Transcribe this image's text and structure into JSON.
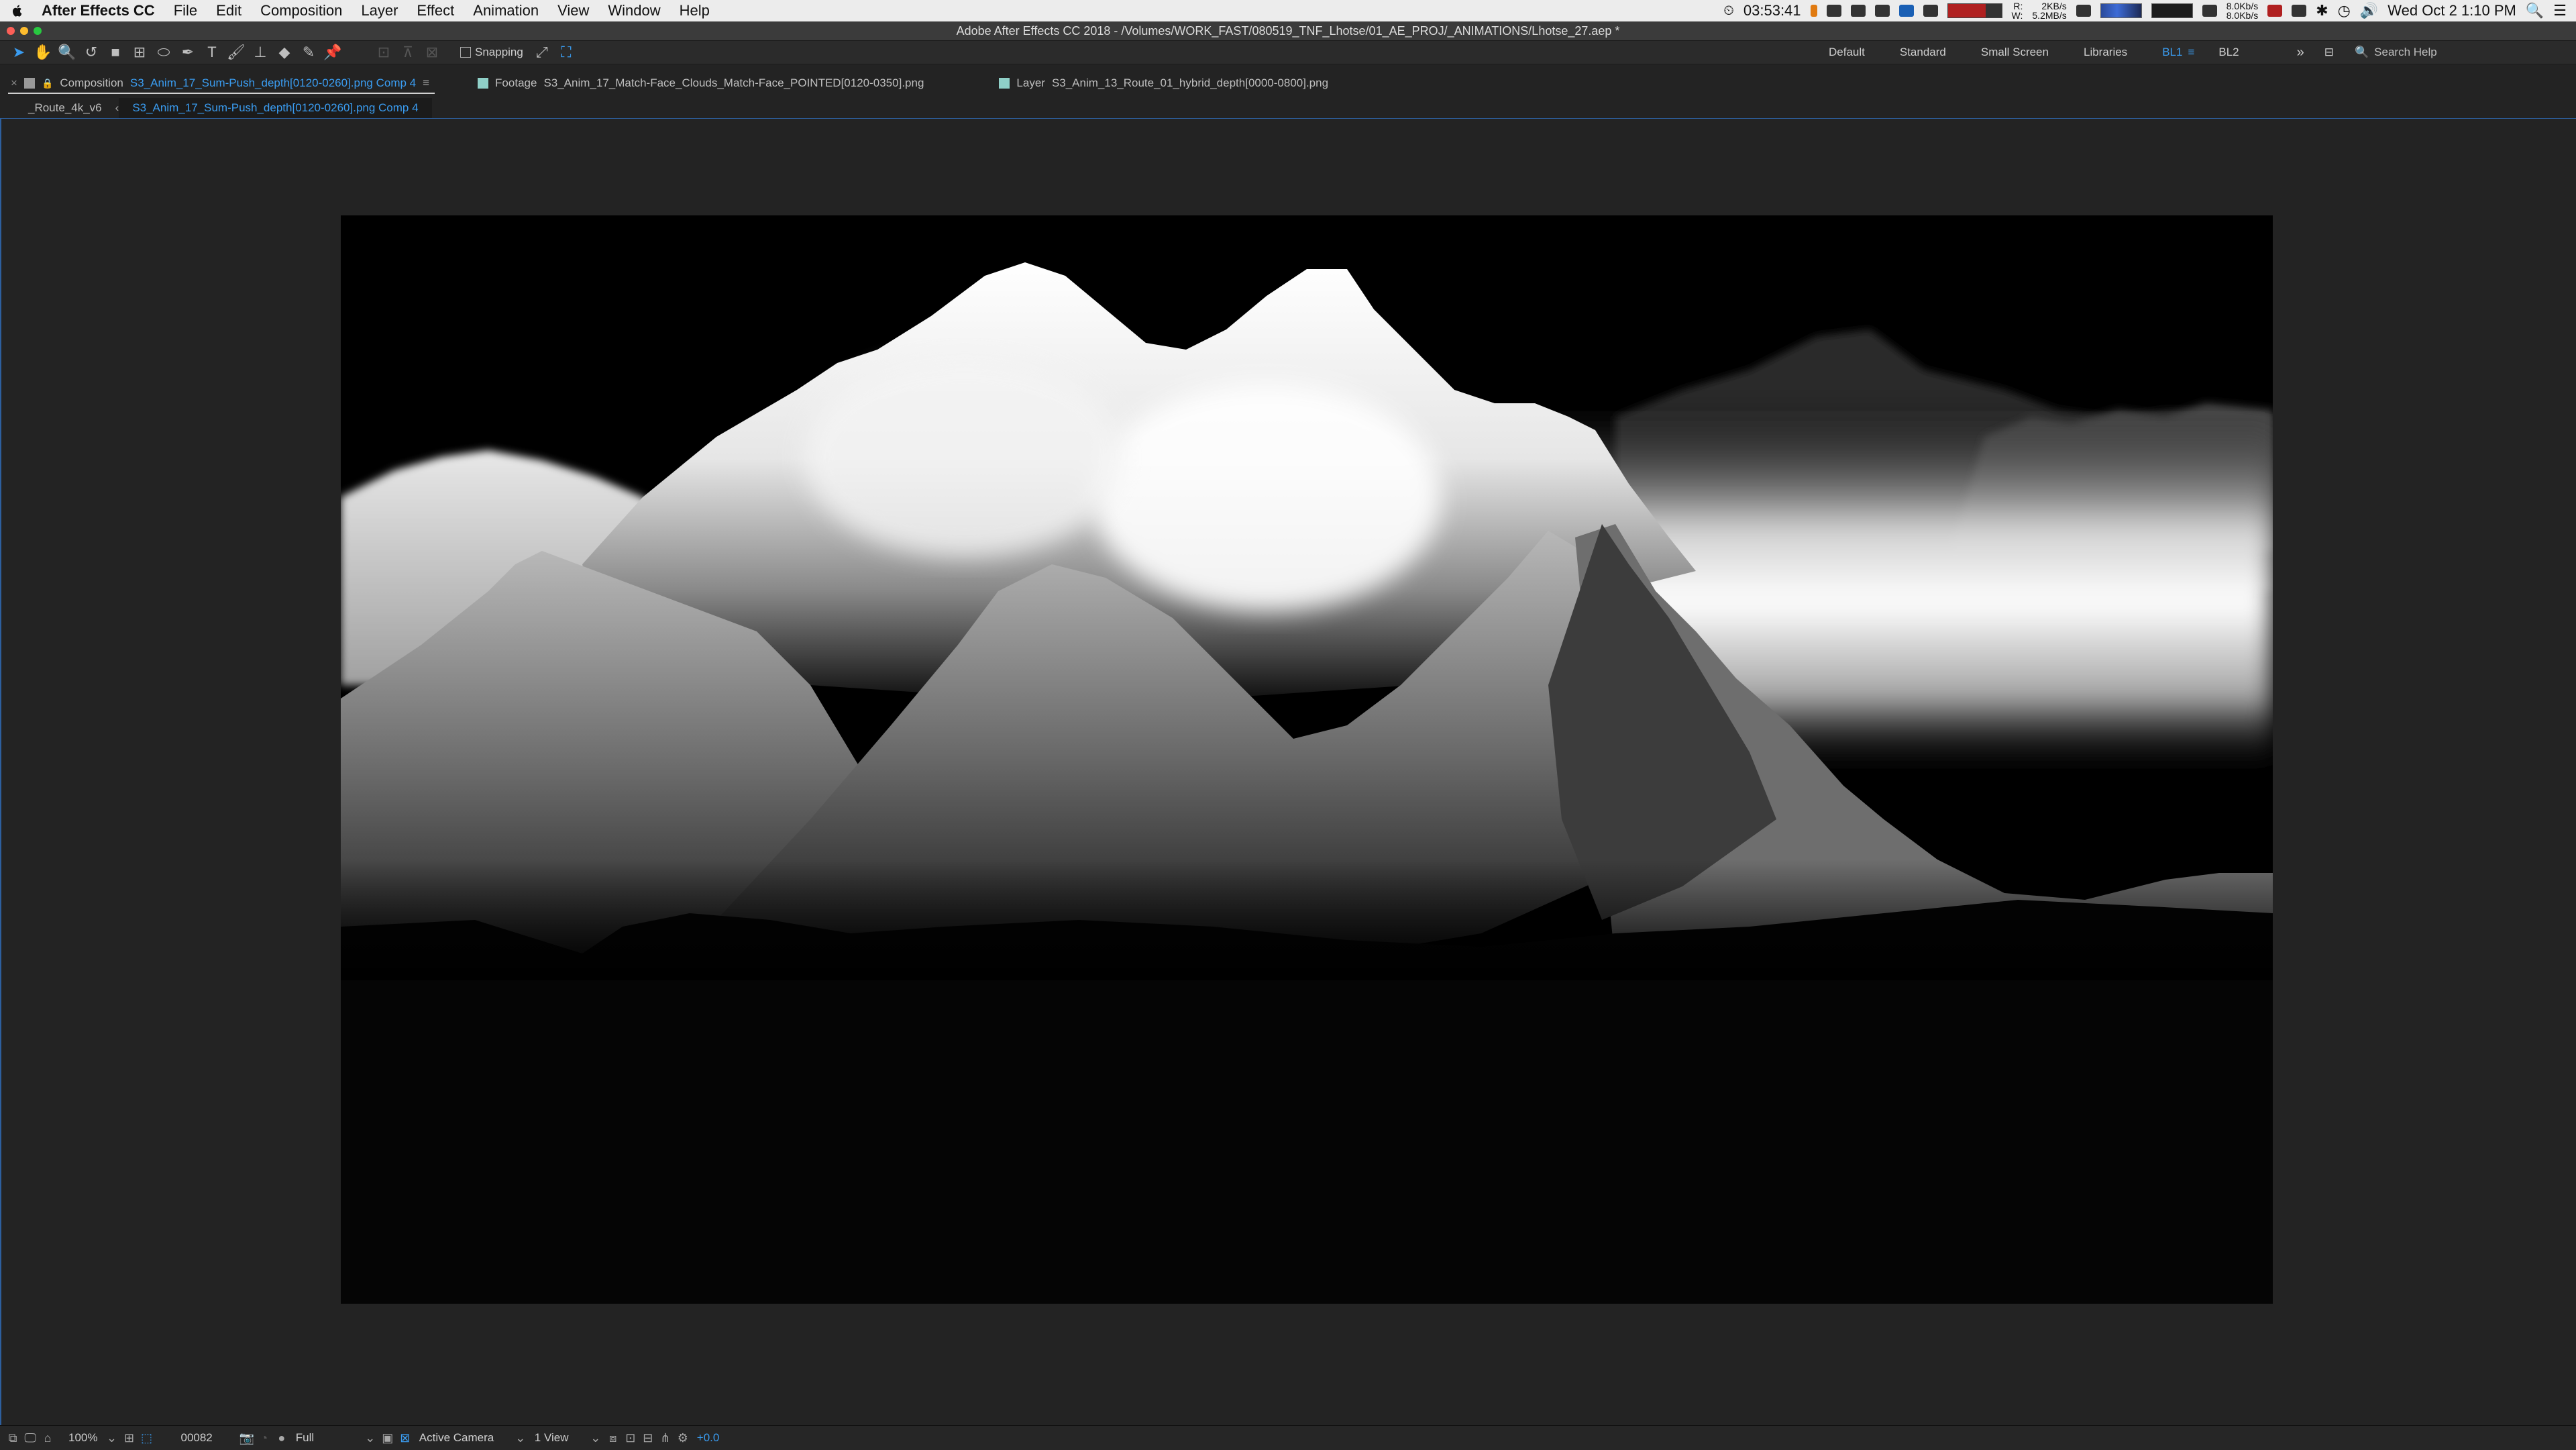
{
  "menubar": {
    "app_name": "After Effects CC",
    "items": [
      "File",
      "Edit",
      "Composition",
      "Layer",
      "Effect",
      "Animation",
      "View",
      "Window",
      "Help"
    ],
    "status": {
      "timer": "03:53:41",
      "net_r_label": "R:",
      "net_w_label": "W:",
      "net_r_value": "2KB/s",
      "net_w_value": "5.2MB/s",
      "net_up": "8.0Kb/s",
      "net_down": "8.0Kb/s",
      "datetime": "Wed Oct 2  1:10 PM"
    }
  },
  "window": {
    "title": "Adobe After Effects CC 2018 - /Volumes/WORK_FAST/080519_TNF_Lhotse/01_AE_PROJ/_ANIMATIONS/Lhotse_27.aep *"
  },
  "toolbar": {
    "snapping_label": "Snapping",
    "workspaces": [
      {
        "label": "Default",
        "active": false
      },
      {
        "label": "Standard",
        "active": false
      },
      {
        "label": "Small Screen",
        "active": false
      },
      {
        "label": "Libraries",
        "active": false
      },
      {
        "label": "BL1",
        "active": true
      },
      {
        "label": "BL2",
        "active": false
      }
    ],
    "search_placeholder": "Search Help"
  },
  "panel_tabs": [
    {
      "prefix": "Composition",
      "name": "S3_Anim_17_Sum-Push_depth[0120-0260].png Comp 4",
      "active": true,
      "swatch": "#9a9a9a"
    },
    {
      "prefix": "Footage",
      "name": "S3_Anim_17_Match-Face_Clouds_Match-Face_POINTED[0120-0350].png",
      "active": false,
      "swatch": "#8fd0c8"
    },
    {
      "prefix": "Layer",
      "name": "S3_Anim_13_Route_01_hybrid_depth[0000-0800].png",
      "active": false,
      "swatch": "#8fd0c8"
    }
  ],
  "breadcrumb": [
    "_Route_4k_v6",
    "S3_Anim_17_Sum-Push_depth[0120-0260].png Comp 4"
  ],
  "viewer_controls": {
    "zoom": "100%",
    "timecode": "00082",
    "resolution": "Full",
    "camera": "Active Camera",
    "views": "1 View",
    "exposure": "+0.0"
  },
  "colors": {
    "accent": "#3a9cf0",
    "panel_bg": "#232323",
    "viewer_border": "#2d5f9e",
    "menubar_bg": "#ececec"
  }
}
